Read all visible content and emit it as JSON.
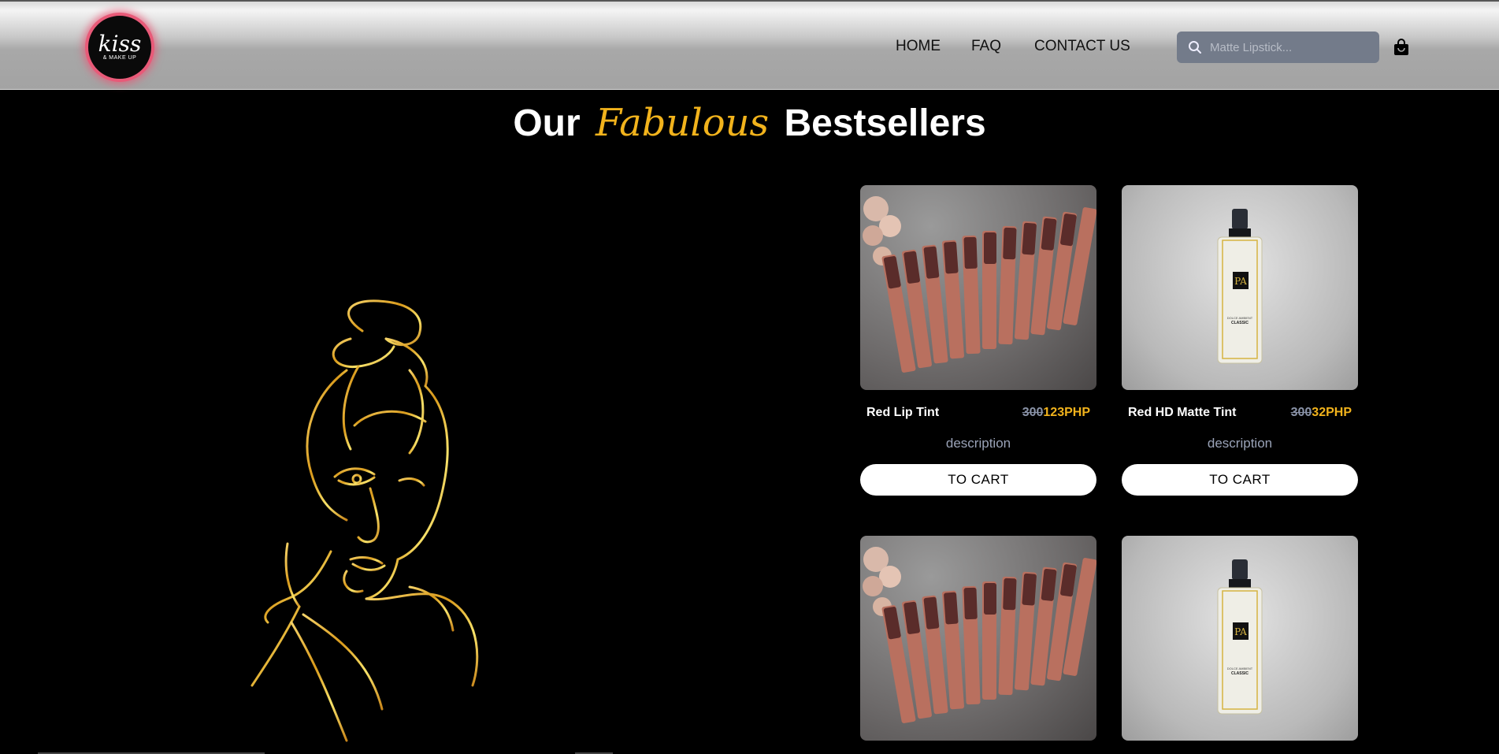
{
  "header": {
    "logo_text": "kiss",
    "logo_sub": "& MAKE UP",
    "nav": [
      {
        "label": "HOME"
      },
      {
        "label": "FAQ"
      },
      {
        "label": "CONTACT US"
      }
    ],
    "search": {
      "placeholder": "Matte Lipstick...",
      "icon": "search-icon"
    },
    "cart_icon": "shopping-bag-icon"
  },
  "section": {
    "title_before": "Our",
    "title_accent": "Fabulous",
    "title_after": "Bestsellers",
    "accent_color": "#f2b31c"
  },
  "products": [
    {
      "name": "Red Lip Tint",
      "old_price": "300",
      "new_price": "123PHP",
      "description": "description",
      "button": "TO CART",
      "image": "lip-tint-photo"
    },
    {
      "name": "Red HD Matte Tint",
      "old_price": "300",
      "new_price": "32PHP",
      "description": "description",
      "button": "TO CART",
      "image": "setting-spray-photo"
    },
    {
      "image": "lip-tint-photo"
    },
    {
      "image": "setting-spray-photo"
    }
  ],
  "bottle_label": {
    "brand": "PA",
    "line1": "DOLCE AMBIENT",
    "line2": "CLASSIC"
  }
}
